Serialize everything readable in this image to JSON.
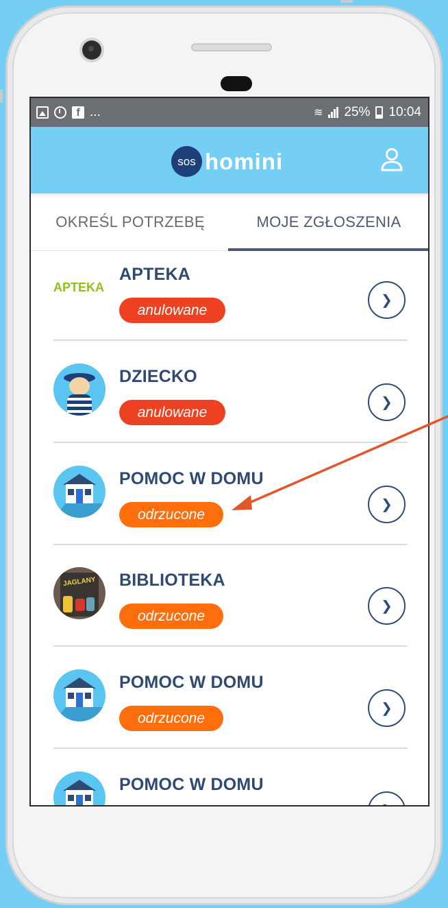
{
  "status_bar": {
    "ellipsis": "...",
    "battery": "25%",
    "time": "10:04"
  },
  "app": {
    "logo_badge": "sos",
    "logo_text": "homini"
  },
  "tabs": [
    {
      "label": "OKREŚL POTRZEBĘ",
      "active": false
    },
    {
      "label": "MOJE ZGŁOSZENIA",
      "active": true
    }
  ],
  "items": [
    {
      "title": "APTEKA",
      "status": "anulowane",
      "status_color": "#ee4122",
      "icon": "apteka-logo",
      "icon_text": "APTEKA"
    },
    {
      "title": "DZIECKO",
      "status": "anulowane",
      "status_color": "#ee4122",
      "icon": "child-avatar"
    },
    {
      "title": "POMOC W DOMU",
      "status": "odrzucone",
      "status_color": "#ff6e0d",
      "icon": "house-avatar"
    },
    {
      "title": "BIBLIOTEKA",
      "status": "odrzucone",
      "status_color": "#ff6e0d",
      "icon": "book-cover-avatar"
    },
    {
      "title": "POMOC W DOMU",
      "status": "odrzucone",
      "status_color": "#ff6e0d",
      "icon": "house-avatar"
    },
    {
      "title": "POMOC W DOMU",
      "status": "",
      "status_color": "#ff6e0d",
      "icon": "house-avatar"
    }
  ],
  "colors": {
    "background": "#75cff5",
    "app_bar": "#75cff5",
    "title": "#2f4a72",
    "annotation_arrow": "#e2562a"
  }
}
